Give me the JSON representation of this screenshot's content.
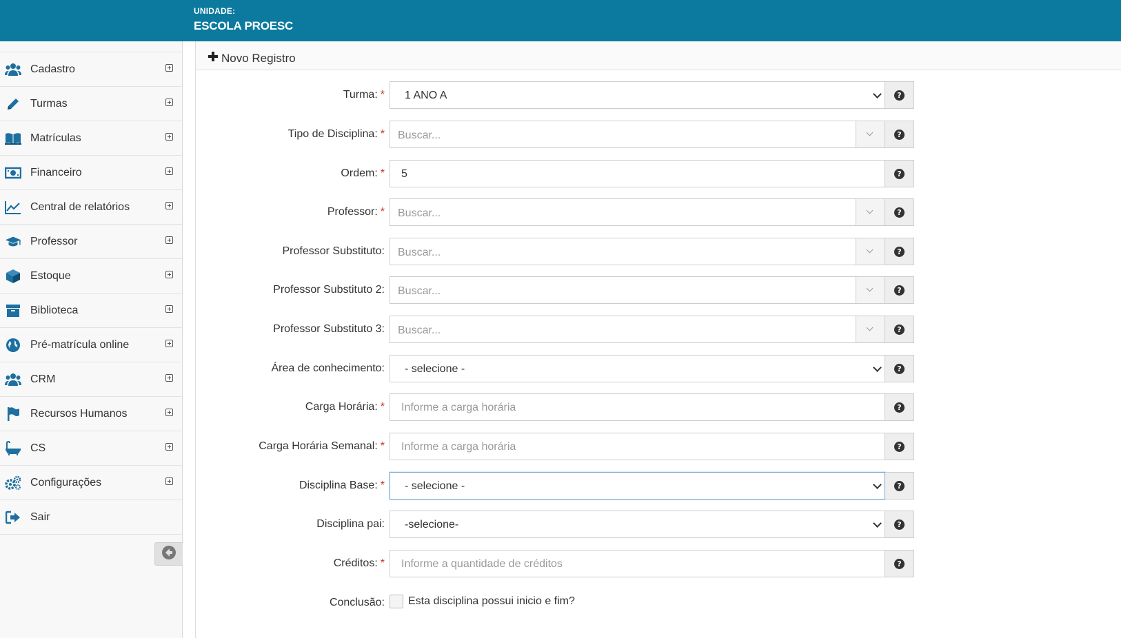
{
  "header": {
    "unit_label": "UNIDADE:",
    "unit_name": "ESCOLA PROESC",
    "bg_color": "#0b7a9e"
  },
  "sidebar": {
    "items": [
      {
        "label": "Cadastro",
        "icon": "users-icon"
      },
      {
        "label": "Turmas",
        "icon": "pencil-icon"
      },
      {
        "label": "Matrículas",
        "icon": "book-open-icon"
      },
      {
        "label": "Financeiro",
        "icon": "money-icon"
      },
      {
        "label": "Central de relatórios",
        "icon": "line-chart-icon"
      },
      {
        "label": "Professor",
        "icon": "graduation-cap-icon"
      },
      {
        "label": "Estoque",
        "icon": "cube-icon"
      },
      {
        "label": "Biblioteca",
        "icon": "archive-icon"
      },
      {
        "label": "Pré-matrícula online",
        "icon": "globe-icon"
      },
      {
        "label": "CRM",
        "icon": "users-icon"
      },
      {
        "label": "Recursos Humanos",
        "icon": "flag-icon"
      },
      {
        "label": "CS",
        "icon": "bathtub-icon"
      },
      {
        "label": "Configurações",
        "icon": "gears-icon"
      },
      {
        "label": "Sair",
        "icon": "sign-out-icon"
      }
    ]
  },
  "panel": {
    "title": "Novo Registro"
  },
  "form": {
    "turma": {
      "label": "Turma:",
      "required": "*",
      "value": "1 ANO A"
    },
    "tipo_disciplina": {
      "label": "Tipo de Disciplina:",
      "required": "*",
      "placeholder": "Buscar..."
    },
    "ordem": {
      "label": "Ordem:",
      "required": "*",
      "value": "5"
    },
    "professor": {
      "label": "Professor:",
      "required": "*",
      "placeholder": "Buscar..."
    },
    "professor_sub": {
      "label": "Professor Substituto:",
      "placeholder": "Buscar..."
    },
    "professor_sub2": {
      "label": "Professor Substituto 2:",
      "placeholder": "Buscar..."
    },
    "professor_sub3": {
      "label": "Professor Substituto 3:",
      "placeholder": "Buscar..."
    },
    "area": {
      "label": "Área de conhecimento:",
      "value": "- selecione -"
    },
    "carga": {
      "label": "Carga Horária:",
      "required": "*",
      "placeholder": "Informe a carga horária"
    },
    "carga_semanal": {
      "label": "Carga Horária Semanal:",
      "required": "*",
      "placeholder": "Informe a carga horária"
    },
    "disciplina_base": {
      "label": "Disciplina Base:",
      "required": "*",
      "value": "- selecione -"
    },
    "disciplina_pai": {
      "label": "Disciplina pai:",
      "value": "-selecione-"
    },
    "creditos": {
      "label": "Créditos:",
      "required": "*",
      "placeholder": "Informe a quantidade de créditos"
    },
    "conclusao": {
      "label": "Conclusão:",
      "checkbox_text": "Esta disciplina possui inicio e fim?"
    },
    "help_glyph": "?"
  }
}
